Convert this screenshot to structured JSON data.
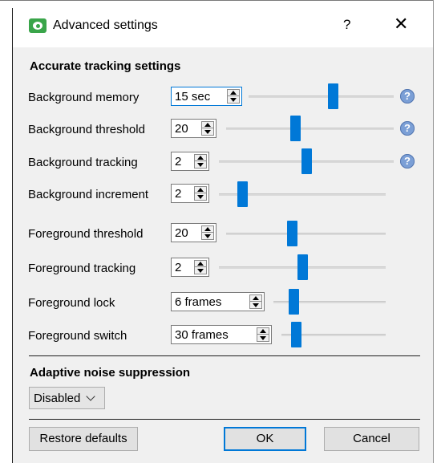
{
  "window": {
    "title": "Advanced settings",
    "help_glyph": "?",
    "close_glyph": "✕",
    "app_icon": "eye-logo-icon"
  },
  "tracking": {
    "section_title": "Accurate tracking settings",
    "rows": [
      {
        "label": "Background memory",
        "value": "15 sec",
        "level": 0.59,
        "help": true
      },
      {
        "label": "Background threshold",
        "value": "20",
        "level": 0.41,
        "help": true
      },
      {
        "label": "Background tracking",
        "value": "2",
        "level": 0.5,
        "help": true
      },
      {
        "label": "Background increment",
        "value": "2",
        "level": 0.12,
        "help": false
      },
      {
        "label": "Foreground threshold",
        "value": "20",
        "level": 0.41,
        "help": false
      },
      {
        "label": "Foreground tracking",
        "value": "2",
        "level": 0.5,
        "help": false
      },
      {
        "label": "Foreground lock",
        "value": "6 frames",
        "level": 0.15,
        "help": false
      },
      {
        "label": "Foreground switch",
        "value": "30 frames",
        "level": 0.1,
        "help": false
      }
    ]
  },
  "noise": {
    "section_title": "Adaptive noise suppression",
    "selected": "Disabled"
  },
  "footer": {
    "restore_label": "Restore defaults",
    "ok_label": "OK",
    "cancel_label": "Cancel"
  },
  "colors": {
    "accent": "#0078d7",
    "help_icon": "#7b9fd6",
    "panel_bg": "#f0f0f0"
  }
}
